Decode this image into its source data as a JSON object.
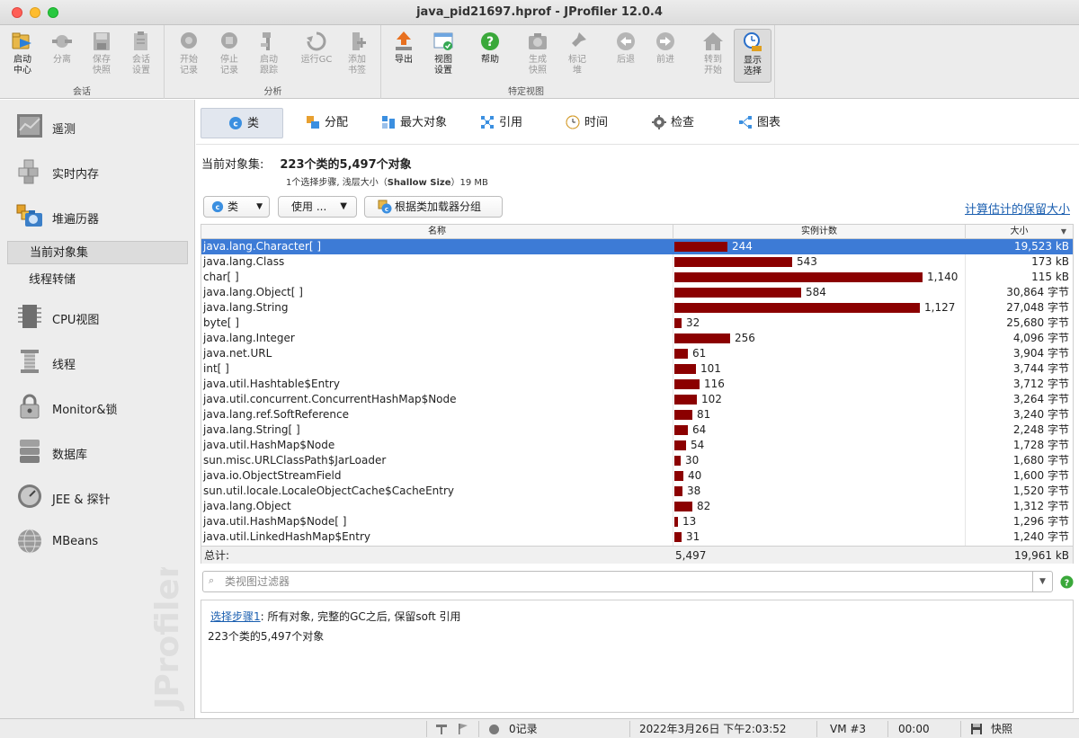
{
  "window": {
    "title": "java_pid21697.hprof - JProfiler 12.0.4"
  },
  "toolbar": {
    "groups": [
      {
        "label": "会话"
      },
      {
        "label": "分析"
      },
      {
        "label": "特定视图"
      }
    ],
    "buttons": [
      {
        "l1": "启动",
        "l2": "中心",
        "icon": "start-center-icon"
      },
      {
        "l1": "分离",
        "l2": "",
        "icon": "detach-icon"
      },
      {
        "l1": "保存",
        "l2": "快照",
        "icon": "save-icon"
      },
      {
        "l1": "会话",
        "l2": "设置",
        "icon": "session-settings-icon"
      },
      {
        "l1": "开始",
        "l2": "记录",
        "icon": "start-recording-icon"
      },
      {
        "l1": "停止",
        "l2": "记录",
        "icon": "stop-recording-icon"
      },
      {
        "l1": "启动",
        "l2": "跟踪",
        "icon": "start-tracking-icon"
      },
      {
        "l1": "运行GC",
        "l2": "",
        "icon": "run-gc-icon"
      },
      {
        "l1": "添加",
        "l2": "书签",
        "icon": "add-bookmark-icon"
      },
      {
        "l1": "导出",
        "l2": "",
        "icon": "export-icon"
      },
      {
        "l1": "视图",
        "l2": "设置",
        "icon": "view-settings-icon"
      },
      {
        "l1": "帮助",
        "l2": "",
        "icon": "help-icon"
      },
      {
        "l1": "生成",
        "l2": "快照",
        "icon": "snapshot-icon"
      },
      {
        "l1": "标记",
        "l2": "堆",
        "icon": "mark-heap-icon"
      },
      {
        "l1": "后退",
        "l2": "",
        "icon": "back-icon"
      },
      {
        "l1": "前进",
        "l2": "",
        "icon": "forward-icon"
      },
      {
        "l1": "转到",
        "l2": "开始",
        "icon": "go-start-icon"
      },
      {
        "l1": "显示",
        "l2": "选择",
        "icon": "show-selection-icon"
      }
    ]
  },
  "sidebar": {
    "items": [
      {
        "label": "遥测",
        "icon": "telemetry-icon"
      },
      {
        "label": "实时内存",
        "icon": "live-memory-icon"
      },
      {
        "label": "堆遍历器",
        "icon": "heap-walker-icon"
      },
      {
        "label": "CPU视图",
        "icon": "cpu-icon"
      },
      {
        "label": "线程",
        "icon": "threads-icon"
      },
      {
        "label": "Monitor&锁",
        "icon": "lock-icon"
      },
      {
        "label": "数据库",
        "icon": "database-icon"
      },
      {
        "label": "JEE & 探针",
        "icon": "probe-icon"
      },
      {
        "label": "MBeans",
        "icon": "mbeans-icon"
      }
    ],
    "sub_items": [
      {
        "label": "当前对象集"
      },
      {
        "label": "线程转储"
      }
    ],
    "watermark": "JProfiler"
  },
  "tabs": [
    {
      "label": "类",
      "icon": "class-icon"
    },
    {
      "label": "分配",
      "icon": "allocation-icon"
    },
    {
      "label": "最大对象",
      "icon": "biggest-objects-icon"
    },
    {
      "label": "引用",
      "icon": "references-icon"
    },
    {
      "label": "时间",
      "icon": "time-icon"
    },
    {
      "label": "检查",
      "icon": "inspection-icon"
    },
    {
      "label": "图表",
      "icon": "graph-icon"
    }
  ],
  "summary": {
    "title_label": "当前对象集:",
    "title_value": "223个类的5,497个对象",
    "sub_prefix": "1个选择步骤, 浅层大小（",
    "sub_bold": "Shallow Size",
    "sub_suffix": "）19 MB"
  },
  "controls": {
    "class_dropdown": "类",
    "use_dropdown": "使用 ...",
    "group_button": "根据类加载器分组",
    "calc_link": "计算估计的保留大小"
  },
  "table": {
    "headers": {
      "name": "名称",
      "count": "实例计数",
      "size": "大小"
    },
    "max_count": 1140,
    "rows": [
      {
        "name": "java.lang.Character[ ]",
        "count": 244,
        "count_text": "244",
        "size": "19,523 kB"
      },
      {
        "name": "java.lang.Class",
        "count": 543,
        "count_text": "543",
        "size": "173 kB"
      },
      {
        "name": "char[ ]",
        "count": 1140,
        "count_text": "1,140",
        "size": "115 kB"
      },
      {
        "name": "java.lang.Object[ ]",
        "count": 584,
        "count_text": "584",
        "size": "30,864 字节"
      },
      {
        "name": "java.lang.String",
        "count": 1127,
        "count_text": "1,127",
        "size": "27,048 字节"
      },
      {
        "name": "byte[ ]",
        "count": 32,
        "count_text": "32",
        "size": "25,680 字节"
      },
      {
        "name": "java.lang.Integer",
        "count": 256,
        "count_text": "256",
        "size": "4,096 字节"
      },
      {
        "name": "java.net.URL",
        "count": 61,
        "count_text": "61",
        "size": "3,904 字节"
      },
      {
        "name": "int[ ]",
        "count": 101,
        "count_text": "101",
        "size": "3,744 字节"
      },
      {
        "name": "java.util.Hashtable$Entry",
        "count": 116,
        "count_text": "116",
        "size": "3,712 字节"
      },
      {
        "name": "java.util.concurrent.ConcurrentHashMap$Node",
        "count": 102,
        "count_text": "102",
        "size": "3,264 字节"
      },
      {
        "name": "java.lang.ref.SoftReference",
        "count": 81,
        "count_text": "81",
        "size": "3,240 字节"
      },
      {
        "name": "java.lang.String[ ]",
        "count": 64,
        "count_text": "64",
        "size": "2,248 字节"
      },
      {
        "name": "java.util.HashMap$Node",
        "count": 54,
        "count_text": "54",
        "size": "1,728 字节"
      },
      {
        "name": "sun.misc.URLClassPath$JarLoader",
        "count": 30,
        "count_text": "30",
        "size": "1,680 字节"
      },
      {
        "name": "java.io.ObjectStreamField",
        "count": 40,
        "count_text": "40",
        "size": "1,600 字节"
      },
      {
        "name": "sun.util.locale.LocaleObjectCache$CacheEntry",
        "count": 38,
        "count_text": "38",
        "size": "1,520 字节"
      },
      {
        "name": "java.lang.Object",
        "count": 82,
        "count_text": "82",
        "size": "1,312 字节"
      },
      {
        "name": "java.util.HashMap$Node[ ]",
        "count": 13,
        "count_text": "13",
        "size": "1,296 字节"
      },
      {
        "name": "java.util.LinkedHashMap$Entry",
        "count": 31,
        "count_text": "31",
        "size": "1,240 字节"
      }
    ],
    "total": {
      "label": "总计:",
      "count": "5,497",
      "size": "19,961 kB"
    }
  },
  "filter": {
    "placeholder": "类视图过滤器"
  },
  "info": {
    "link": "选择步骤1",
    "step_text": ": 所有对象, 完整的GC之后, 保留soft 引用",
    "line2": "223个类的5,497个对象"
  },
  "statusbar": {
    "records": "0记录",
    "datetime": "2022年3月26日 下午2:03:52",
    "vm": "VM #3",
    "elapsed": "00:00",
    "snapshot": "快照"
  },
  "colors": {
    "selection": "#3d7bd6",
    "bar": "#8b0000",
    "link": "#1b5fb0"
  }
}
